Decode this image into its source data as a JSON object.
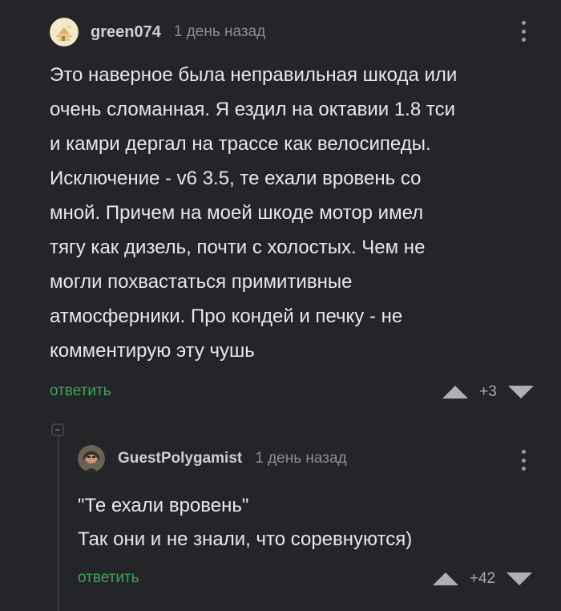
{
  "comments": [
    {
      "username": "green074",
      "time": "1 день назад",
      "text": "Это наверное была неправильная шкода или\nочень сломанная. Я ездил на октавии 1.8 тси\nи камри дергал на трассе как велосипеды.\nИсключение - v6 3.5, те ехали вровень со\nмной. Причем на моей шкоде мотор имел\nтягу как дизель, почти с холостых. Чем не\nмогли похвастаться примитивные\nатмосферники. Про кондей и печку - не\nкомментирую эту чушь",
      "reply_label": "ответить",
      "score": "+3"
    },
    {
      "username": "GuestPolygamist",
      "time": "1 день назад",
      "text": "\"Те ехали вровень\"\nТак они и не знали, что соревнуются)",
      "reply_label": "ответить",
      "score": "+42"
    }
  ],
  "colors": {
    "background": "#232529",
    "reply": "#3fa45b",
    "muted": "#8b8d91"
  },
  "icons": {
    "menu": "kebab-menu-icon",
    "upvote": "arrow-up-icon",
    "downvote": "arrow-down-icon",
    "collapse": "collapse-thread-icon"
  }
}
